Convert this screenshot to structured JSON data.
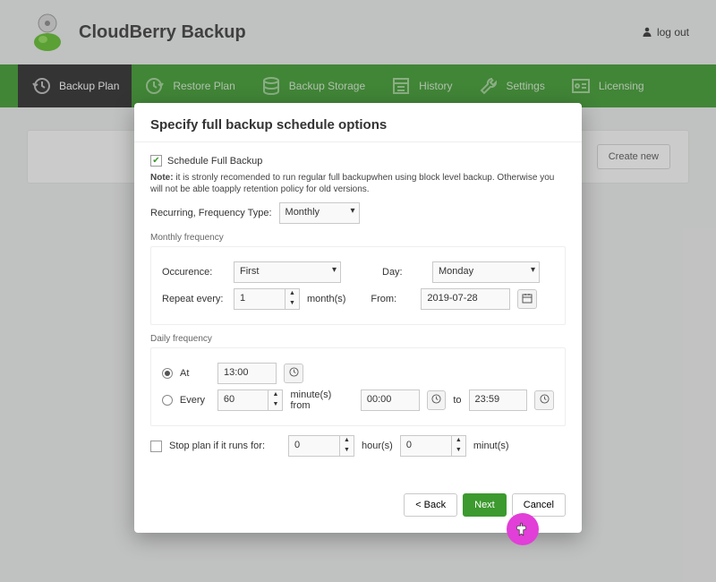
{
  "header": {
    "title": "CloudBerry Backup",
    "logout_label": "log out"
  },
  "nav": {
    "items": [
      {
        "label": "Backup Plan"
      },
      {
        "label": "Restore Plan"
      },
      {
        "label": "Backup Storage"
      },
      {
        "label": "History"
      },
      {
        "label": "Settings"
      },
      {
        "label": "Licensing"
      }
    ]
  },
  "background": {
    "create_label": "Create new"
  },
  "modal": {
    "title": "Specify full backup schedule options",
    "schedule_label": "Schedule Full Backup",
    "schedule_checked": true,
    "note_prefix": "Note:",
    "note_text": "it is stronly recomended to run regular full backupwhen using block level backup. Otherwise you will not be able toapply retention policy for old versions.",
    "freq_type_label": "Recurring, Frequency Type:",
    "freq_type_value": "Monthly",
    "monthly_section": "Monthly frequency",
    "occurence_label": "Occurence:",
    "occurence_value": "First",
    "day_label": "Day:",
    "day_value": "Monday",
    "repeat_label": "Repeat every:",
    "repeat_value": "1",
    "repeat_unit": "month(s)",
    "from_label": "From:",
    "from_value": "2019-07-28",
    "daily_section": "Daily frequency",
    "radio_choice": "at",
    "at_label": "At",
    "at_value": "13:00",
    "every_label": "Every",
    "every_value": "60",
    "every_unit": "minute(s) from",
    "every_from": "00:00",
    "every_to_label": "to",
    "every_to": "23:59",
    "stop_label": "Stop plan if it runs for:",
    "stop_checked": false,
    "stop_hours": "0",
    "stop_hours_unit": "hour(s)",
    "stop_minutes": "0",
    "stop_minutes_unit": "minut(s)",
    "footer": {
      "back_label": "< Back",
      "next_label": "Next",
      "cancel_label": "Cancel"
    }
  }
}
